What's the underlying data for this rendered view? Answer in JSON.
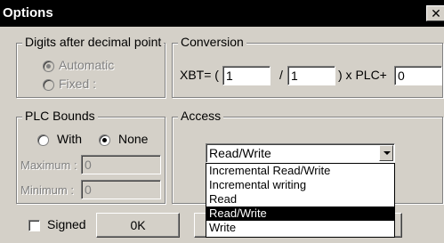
{
  "window": {
    "title": "Options",
    "close_glyph": "✕"
  },
  "digits_group": {
    "legend": "Digits after decimal point",
    "options": [
      {
        "label": "Automatic",
        "selected": true,
        "enabled": false
      },
      {
        "label": "Fixed :",
        "selected": false,
        "enabled": false
      }
    ]
  },
  "conversion_group": {
    "legend": "Conversion",
    "xbt_label": "XBT= (",
    "numerator": "1",
    "divide_label": "/",
    "denominator": "1",
    "plc_label": ") x PLC+",
    "offset": "0"
  },
  "plc_bounds_group": {
    "legend": "PLC Bounds",
    "with_label": "With",
    "none_label": "None",
    "selected": "None",
    "maximum_label": "Maximum :",
    "maximum_value": "0",
    "minimum_label": "Minimum :",
    "minimum_value": "0"
  },
  "access_group": {
    "legend": "Access",
    "selected_value": "Read/Write",
    "options": [
      "Incremental Read/Write",
      "Incremental writing",
      "Read",
      "Read/Write",
      "Write"
    ],
    "highlighted_index": 3
  },
  "footer": {
    "signed_label": "Signed",
    "signed_checked": false,
    "ok_label": "0K"
  },
  "icons": {
    "close": "close-icon",
    "dropdown": "chevron-down-icon"
  }
}
